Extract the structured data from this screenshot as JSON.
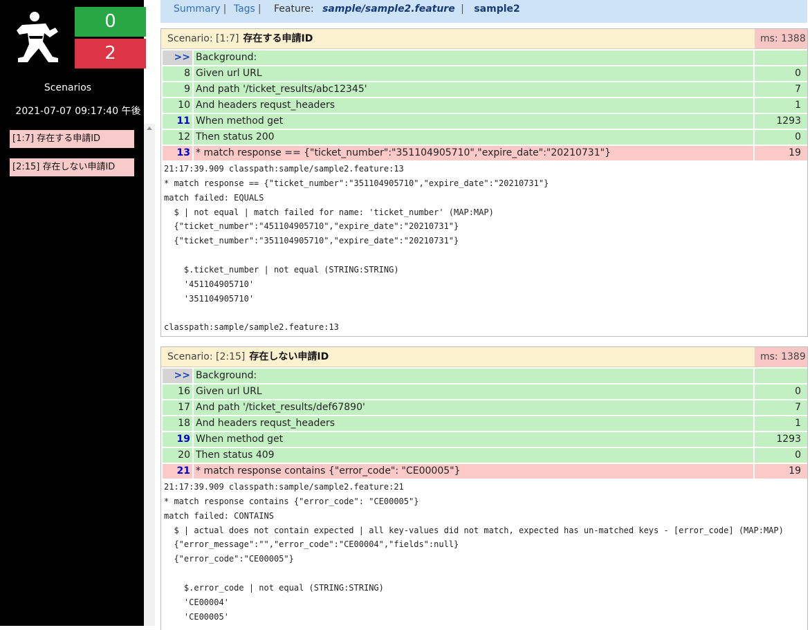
{
  "sidebar": {
    "passed_count": "0",
    "failed_count": "2",
    "scenarios_label": "Scenarios",
    "timestamp": "2021-07-07 09:17:40 午後",
    "nav": [
      "[1:7] 存在する申請ID",
      "[2:15] 存在しない申請ID"
    ]
  },
  "topbar": {
    "summary": "Summary",
    "tags": "Tags",
    "feature_label": "Feature:",
    "feature_path": "sample/sample2.feature",
    "feature_name": "sample2"
  },
  "colors": {
    "pass": "#c3f0c3",
    "fail": "#fcc9c9",
    "passed_box": "#28a745",
    "failed_box": "#dc3545",
    "header": "#fdf2cf"
  },
  "scenarios": [
    {
      "label": "Scenario: [1:7]",
      "name": "存在する申請ID",
      "ms": "ms: 1388",
      "steps": [
        {
          "line": ">>",
          "text": "Background:",
          "ms": ""
        },
        {
          "line": "8",
          "text": "Given url URL",
          "ms": "0"
        },
        {
          "line": "9",
          "text": "And path '/ticket_results/abc12345'",
          "ms": "7"
        },
        {
          "line": "10",
          "text": "And headers requst_headers",
          "ms": "1"
        },
        {
          "line": "11",
          "text": "When method get",
          "ms": "1293"
        },
        {
          "line": "12",
          "text": "Then status 200",
          "ms": "0"
        },
        {
          "line": "13",
          "text": "* match response == {\"ticket_number\":\"351104905710\",\"expire_date\":\"20210731\"}",
          "ms": "19"
        }
      ],
      "log": [
        "21:17:39.909 classpath:sample/sample2.feature:13",
        "* match response == {\"ticket_number\":\"351104905710\",\"expire_date\":\"20210731\"}",
        "match failed: EQUALS",
        "  $ | not equal | match failed for name: 'ticket_number' (MAP:MAP)",
        "  {\"ticket_number\":\"451104905710\",\"expire_date\":\"20210731\"}",
        "  {\"ticket_number\":\"351104905710\",\"expire_date\":\"20210731\"}",
        "",
        "    $.ticket_number | not equal (STRING:STRING)",
        "    '451104905710'",
        "    '351104905710'",
        "",
        "classpath:sample/sample2.feature:13"
      ]
    },
    {
      "label": "Scenario: [2:15]",
      "name": "存在しない申請ID",
      "ms": "ms: 1389",
      "steps": [
        {
          "line": ">>",
          "text": "Background:",
          "ms": ""
        },
        {
          "line": "16",
          "text": "Given url URL",
          "ms": "0"
        },
        {
          "line": "17",
          "text": "And path '/ticket_results/def67890'",
          "ms": "7"
        },
        {
          "line": "18",
          "text": "And headers requst_headers",
          "ms": "1"
        },
        {
          "line": "19",
          "text": "When method get",
          "ms": "1293"
        },
        {
          "line": "20",
          "text": "Then status 409",
          "ms": "0"
        },
        {
          "line": "21",
          "text": "* match response contains {\"error_code\": \"CE00005\"}",
          "ms": "19"
        }
      ],
      "log": [
        "21:17:39.909 classpath:sample/sample2.feature:21",
        "* match response contains {\"error_code\": \"CE00005\"}",
        "match failed: CONTAINS",
        "  $ | actual does not contain expected | all key-values did not match, expected has un-matched keys - [error_code] (MAP:MAP)",
        "  {\"error_message\":\"\",\"error_code\":\"CE00004\",\"fields\":null}",
        "  {\"error_code\":\"CE00005\"}",
        "",
        "    $.error_code | not equal (STRING:STRING)",
        "    'CE00004'",
        "    'CE00005'"
      ]
    }
  ]
}
